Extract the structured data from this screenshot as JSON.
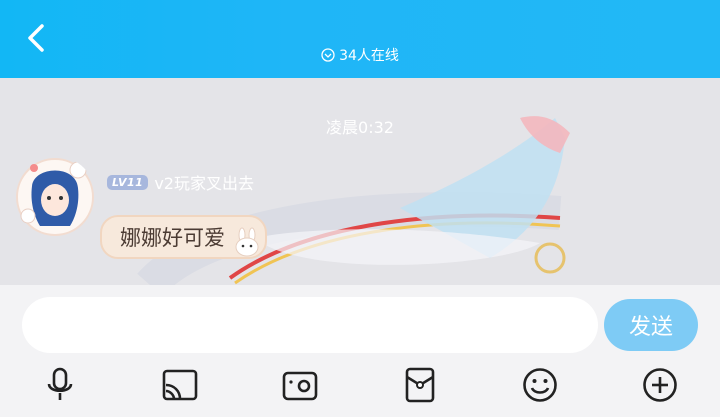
{
  "header": {
    "online_count": "34人在线",
    "bg_color": "#12b7f5"
  },
  "chat": {
    "timestamp": "凌晨0:32",
    "message": {
      "level_badge": "LV11",
      "username": "v2玩家叉出去",
      "text": "娜娜好可爱"
    }
  },
  "input": {
    "placeholder": "",
    "send_label": "发送",
    "send_color": "#7ecbf5"
  },
  "toolbar": {
    "icons": [
      "microphone-icon",
      "screen-cast-icon",
      "photo-icon",
      "red-packet-icon",
      "emoji-icon",
      "plus-icon"
    ]
  }
}
